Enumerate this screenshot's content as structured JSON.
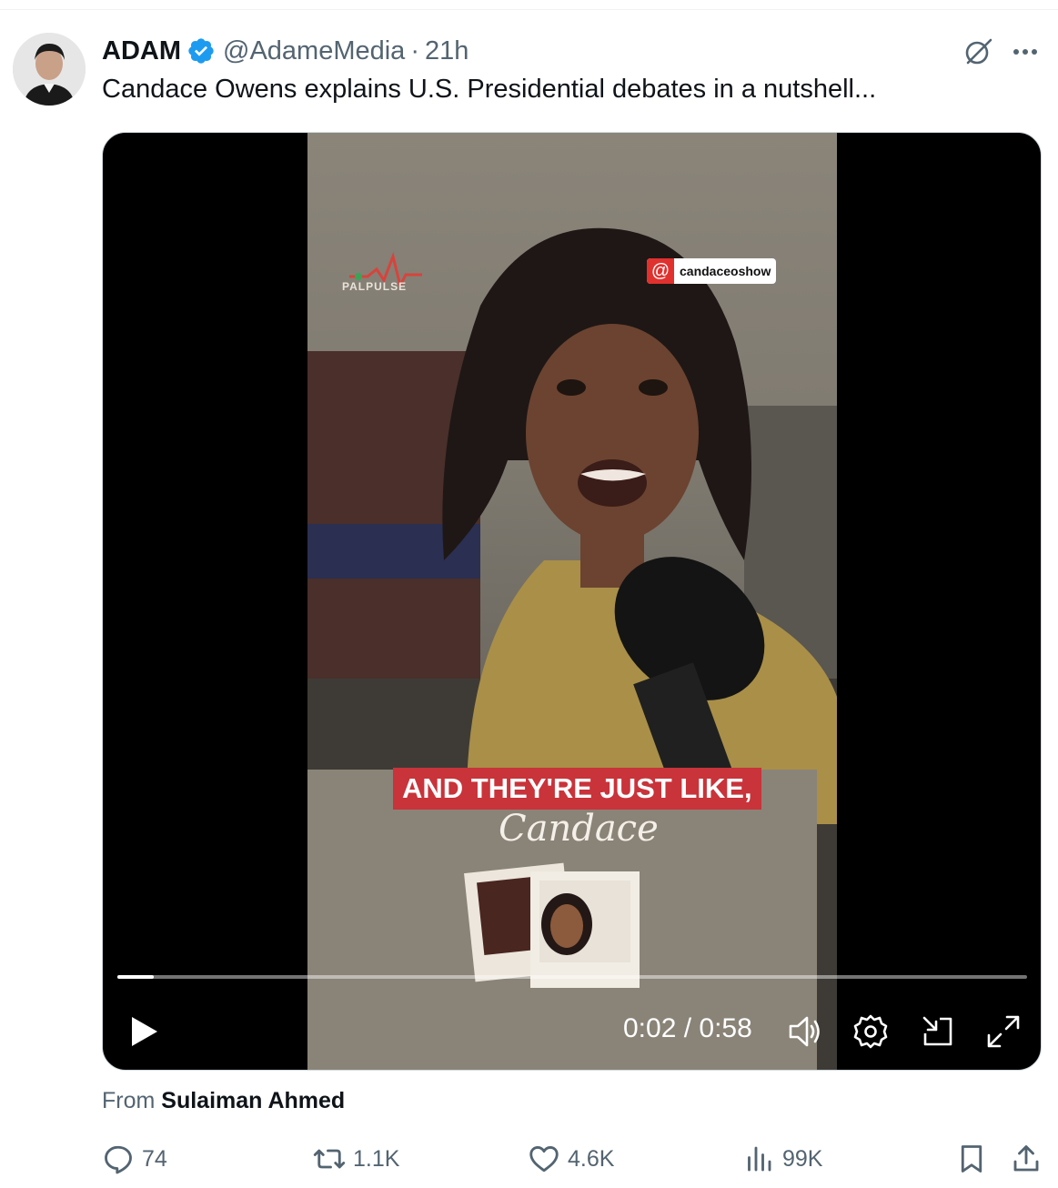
{
  "author": {
    "name": "ADAM",
    "handle": "@AdameMedia",
    "separator": "·",
    "time": "21h"
  },
  "tweet": {
    "text": "Candace Owens explains U.S. Presidential debates in a nutshell..."
  },
  "video": {
    "watermark": "PALPULSE",
    "instagram_handle": "candaceoshow",
    "caption": "AND THEY'RE JUST LIKE,",
    "script_text": "Candace",
    "time_readout": "0:02 / 0:58",
    "progress_fraction": 0.04
  },
  "source": {
    "prefix": "From",
    "name": "Sulaiman Ahmed"
  },
  "actions": {
    "replies": "74",
    "reposts": "1.1K",
    "likes": "4.6K",
    "views": "99K"
  },
  "colors": {
    "verified": "#1d9bf0",
    "text_secondary": "#536471",
    "caption_bg": "#c9333a"
  },
  "icons": [
    "verified-badge-icon",
    "grok-icon",
    "more-icon",
    "play-icon",
    "volume-icon",
    "settings-icon",
    "minimize-icon",
    "fullscreen-icon",
    "reply-icon",
    "repost-icon",
    "like-icon",
    "views-icon",
    "bookmark-icon",
    "share-icon"
  ]
}
